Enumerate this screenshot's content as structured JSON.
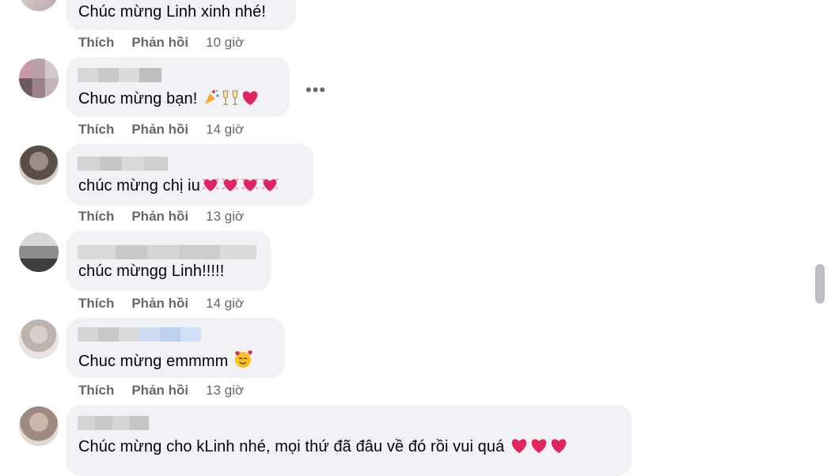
{
  "actions": {
    "like": "Thích",
    "reply": "Phản hồi"
  },
  "more_glyph": "•••",
  "comments": [
    {
      "text": "Chúc mừng Linh xinh nhé!",
      "time": "10 giờ"
    },
    {
      "text": "Chuc mừng bạn!",
      "time": "14 giờ",
      "emojis": [
        "party-popper-icon",
        "champagne-glasses-icon",
        "red-heart-icon"
      ]
    },
    {
      "text": "chúc mừng chị iu",
      "time": "13 giờ",
      "emojis": [
        "heart-with-sparkle-icon",
        "heart-with-sparkle-icon",
        "heart-with-sparkle-icon",
        "heart-with-sparkle-icon"
      ]
    },
    {
      "text": "chúc mừngg Linh!!!!!",
      "time": "14 giờ"
    },
    {
      "text": "Chuc mừng emmmm",
      "time": "13 giờ",
      "emojis": [
        "smiling-face-with-hearts-icon"
      ]
    },
    {
      "text": "Chúc mừng cho kLinh nhé, mọi thứ đã đâu về đó rồi vui quá",
      "time": "",
      "emojis": [
        "red-heart-icon",
        "red-heart-icon",
        "red-heart-icon"
      ]
    }
  ]
}
